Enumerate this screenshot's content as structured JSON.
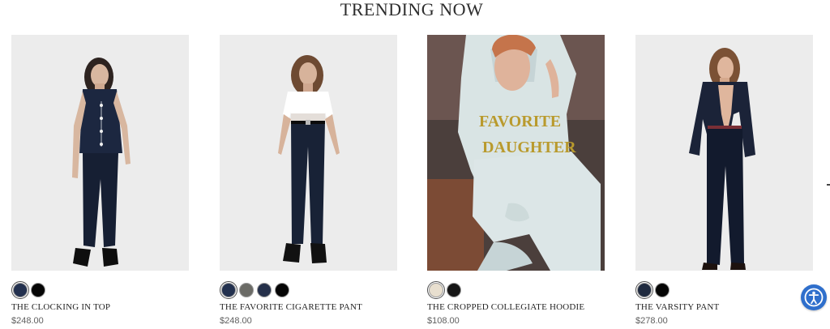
{
  "section": {
    "title": "TRENDING NOW"
  },
  "products": [
    {
      "name": "THE CLOCKING IN TOP",
      "price": "$248.00",
      "image_icon": "sleeveless-pinstripe-top-photo",
      "swatches": [
        {
          "color": "#23314f",
          "selected": true
        },
        {
          "color": "#050505",
          "selected": false
        }
      ]
    },
    {
      "name": "THE FAVORITE CIGARETTE PANT",
      "price": "$248.00",
      "image_icon": "cigarette-pant-photo",
      "swatches": [
        {
          "color": "#23314f",
          "selected": true
        },
        {
          "color": "#6b6b66",
          "selected": false
        },
        {
          "color": "#25304a",
          "selected": false
        },
        {
          "color": "#050505",
          "selected": false
        }
      ]
    },
    {
      "name": "THE CROPPED COLLEGIATE HOODIE",
      "price": "$108.00",
      "image_icon": "cropped-hoodie-photo",
      "swatches": [
        {
          "color": "#e8dfcf",
          "selected": true
        },
        {
          "color": "#161616",
          "selected": false
        }
      ]
    },
    {
      "name": "THE VARSITY PANT",
      "price": "$278.00",
      "image_icon": "varsity-pant-photo",
      "swatches": [
        {
          "color": "#1f2a3f",
          "selected": true
        },
        {
          "color": "#050505",
          "selected": false
        }
      ]
    }
  ],
  "hoodie_print": {
    "line1": "FAVORITE",
    "line2": "DAUGHTER"
  },
  "accessibility": {
    "icon": "accessibility-icon",
    "color": "#2f6fcc"
  }
}
